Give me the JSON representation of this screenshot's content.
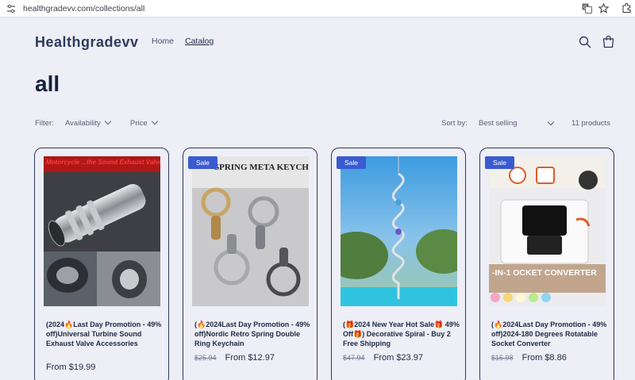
{
  "browser": {
    "url": "healthgradevv.com/collections/all"
  },
  "header": {
    "brand": "Healthgradevv",
    "nav": [
      {
        "label": "Home"
      },
      {
        "label": "Catalog"
      }
    ]
  },
  "page": {
    "title": "all"
  },
  "filters": {
    "label": "Filter:",
    "availability": "Availability",
    "price": "Price",
    "sort_label": "Sort by:",
    "sort_value": "Best selling",
    "count": "11 products"
  },
  "products": [
    {
      "title": "(2024🔥Last Day Promotion - 49% off)Universal Turbine Sound Exhaust Valve Accessories",
      "old_price": "",
      "price": "From $19.99",
      "badge": "",
      "image_text": "Motorcycle ...the Sound Exhaust Valve"
    },
    {
      "title": "(🔥2024Last Day Promotion - 49% off)Nordic Retro Spring Double Ring Keychain",
      "old_price": "$25.94",
      "price": "From $12.97",
      "badge": "Sale",
      "image_text": "SPRING META KEYCHAI"
    },
    {
      "title": "(🎁2024 New Year Hot Sale🎁 49% Off🎁) Decorative Spiral - Buy 2 Free Shipping",
      "old_price": "$47.94",
      "price": "From $23.97",
      "badge": "Sale",
      "image_text": ""
    },
    {
      "title": "(🔥2024Last Day Promotion - 49% off)2024-180 Degrees Rotatable Socket Converter",
      "old_price": "$15.98",
      "price": "From $8.86",
      "badge": "Sale",
      "image_text": "-IN-1 OCKET CONVERTER"
    }
  ],
  "colors": {
    "background": "#edeef6",
    "accent": "#3a5bd0",
    "text": "#1f2a44"
  }
}
